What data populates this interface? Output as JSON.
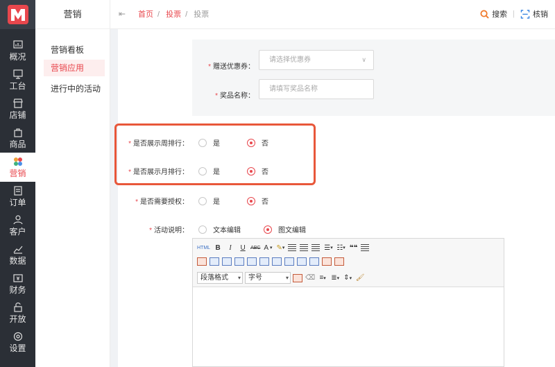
{
  "app": {
    "brand_color": "#e8474d",
    "rail": [
      {
        "name": "overview",
        "label": "概况",
        "icon": "chart-icon"
      },
      {
        "name": "workbench",
        "label": "工台",
        "icon": "monitor-icon"
      },
      {
        "name": "store",
        "label": "店铺",
        "icon": "store-icon"
      },
      {
        "name": "goods",
        "label": "商品",
        "icon": "bag-icon"
      },
      {
        "name": "marketing",
        "label": "营销",
        "icon": "marketing-icon",
        "active": true
      },
      {
        "name": "orders",
        "label": "订单",
        "icon": "order-icon"
      },
      {
        "name": "customers",
        "label": "客户",
        "icon": "user-icon"
      },
      {
        "name": "data",
        "label": "数据",
        "icon": "analytics-icon"
      },
      {
        "name": "finance",
        "label": "财务",
        "icon": "finance-icon"
      },
      {
        "name": "open",
        "label": "开放",
        "icon": "open-icon"
      },
      {
        "name": "settings",
        "label": "设置",
        "icon": "gear-icon"
      }
    ]
  },
  "subnav": {
    "title": "营销",
    "items": [
      {
        "label": "营销看板"
      },
      {
        "label": "营销应用",
        "active": true
      },
      {
        "label": "进行中的活动"
      }
    ]
  },
  "topbar": {
    "collapse_icon": "⇤",
    "breadcrumb": [
      "首页",
      "投票",
      "投票"
    ],
    "search_label": "搜索",
    "verify_label": "核销"
  },
  "form": {
    "coupon": {
      "label": "赠送优惠券：",
      "placeholder": "请选择优惠券"
    },
    "prize": {
      "label": "奖品名称：",
      "placeholder": "请填写奖品名称"
    },
    "weekly_rank": {
      "label": "是否展示周排行：",
      "options": [
        "是",
        "否"
      ],
      "selected": "否"
    },
    "monthly_rank": {
      "label": "是否展示月排行：",
      "options": [
        "是",
        "否"
      ],
      "selected": "否"
    },
    "auth": {
      "label": "是否需要授权：",
      "options": [
        "是",
        "否"
      ],
      "selected": "否"
    },
    "desc": {
      "label": "活动说明：",
      "options": [
        "文本编辑",
        "图文编辑"
      ],
      "selected": "图文编辑"
    }
  },
  "editor": {
    "html_label": "HTML",
    "bold": "B",
    "italic": "I",
    "underline": "U",
    "strike": "ABC",
    "font_color": "A",
    "quote": "❝❝",
    "paragraph_format": "段落格式",
    "font_name": "字号"
  }
}
